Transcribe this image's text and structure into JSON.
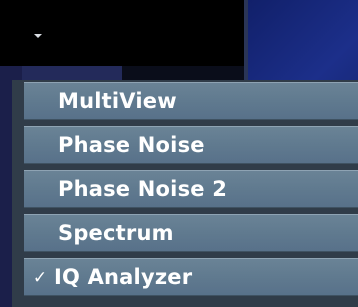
{
  "toggle": {
    "icon": "chevron-down-icon"
  },
  "menu": {
    "items": [
      {
        "label": "MultiView",
        "checked": false
      },
      {
        "label": "Phase Noise",
        "checked": false
      },
      {
        "label": "Phase Noise 2",
        "checked": false
      },
      {
        "label": "Spectrum",
        "checked": false
      },
      {
        "label": "IQ Analyzer",
        "checked": true,
        "check_mark": "✓"
      }
    ]
  },
  "colors": {
    "menu_item_bg": "#607a8f",
    "menu_bg": "#303c49",
    "text": "#ffffff",
    "right_panel": "#1c2f8a"
  }
}
